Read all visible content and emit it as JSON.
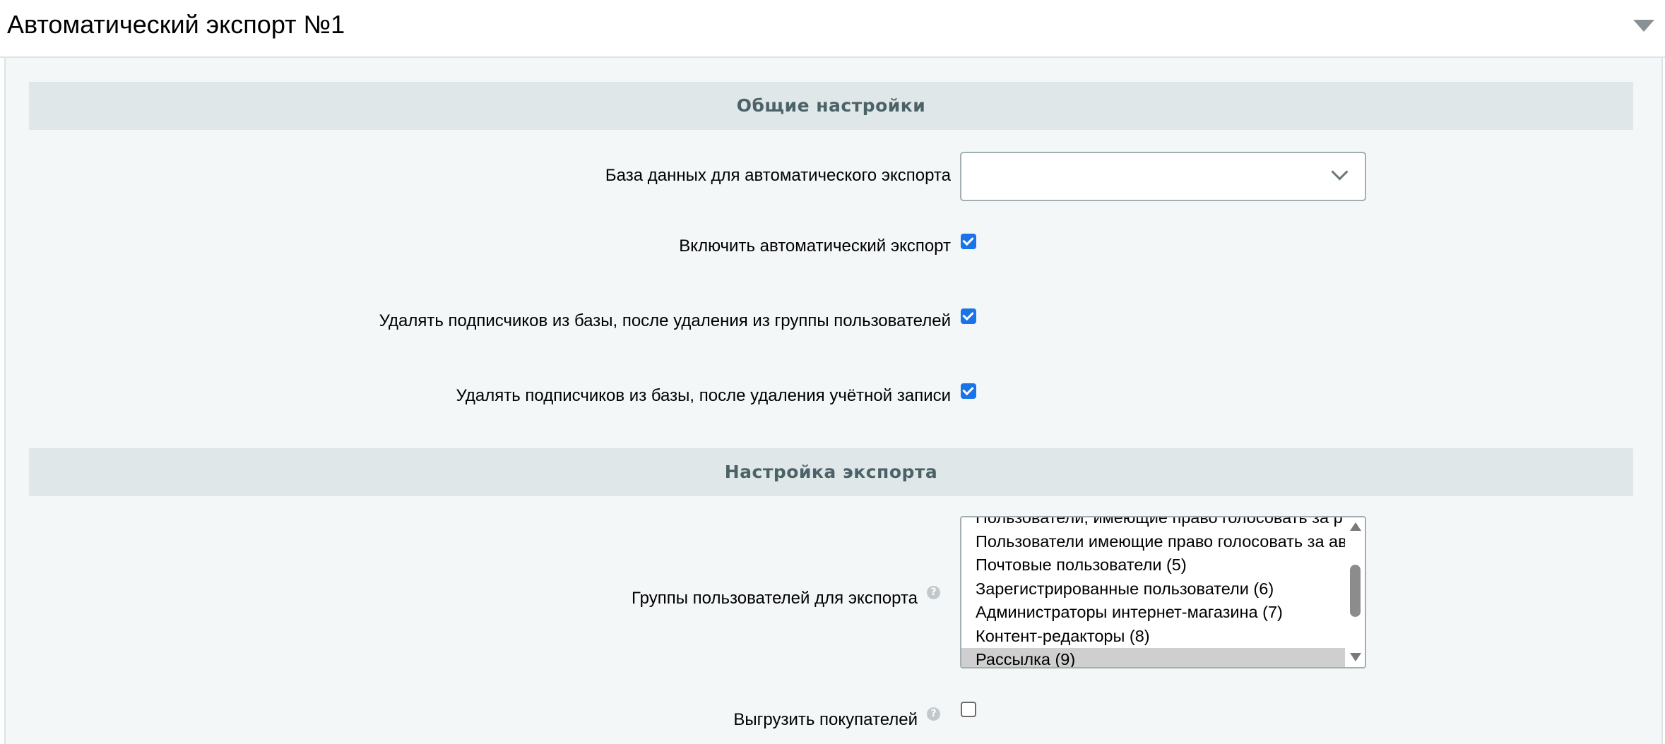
{
  "page": {
    "title": "Автоматический экспорт №1"
  },
  "sections": {
    "general": "Общие настройки",
    "export": "Настройка экспорта"
  },
  "fields": {
    "database": {
      "label": "База данных для автоматического экспорта",
      "value": ""
    },
    "enable_auto_export": {
      "label": "Включить автоматический экспорт",
      "checked": true
    },
    "delete_on_group_removal": {
      "label": "Удалять подписчиков из базы, после удаления из группы пользователей",
      "checked": true
    },
    "delete_on_account_removal": {
      "label": "Удалять подписчиков из базы, после удаления учётной записи",
      "checked": true
    },
    "user_groups": {
      "label": "Группы пользователей для экспорта",
      "options": [
        "Пользователи, имеющие право голосовать за р",
        "Пользователи имеющие право голосовать за ав",
        "Почтовые пользователи (5)",
        "Зарегистрированные пользователи (6)",
        "Администраторы интернет-магазина (7)",
        "Контент-редакторы (8)",
        "Рассылка (9)"
      ],
      "selected": "Рассылка (9)"
    },
    "export_buyers": {
      "label": "Выгрузить покупателей",
      "checked": false
    }
  },
  "icons": {
    "help": "?"
  },
  "colors": {
    "accent": "#1a73e8",
    "section_bg": "#e0e7e9",
    "section_text": "#4b6267",
    "panel_bg": "#f4f7f8"
  }
}
